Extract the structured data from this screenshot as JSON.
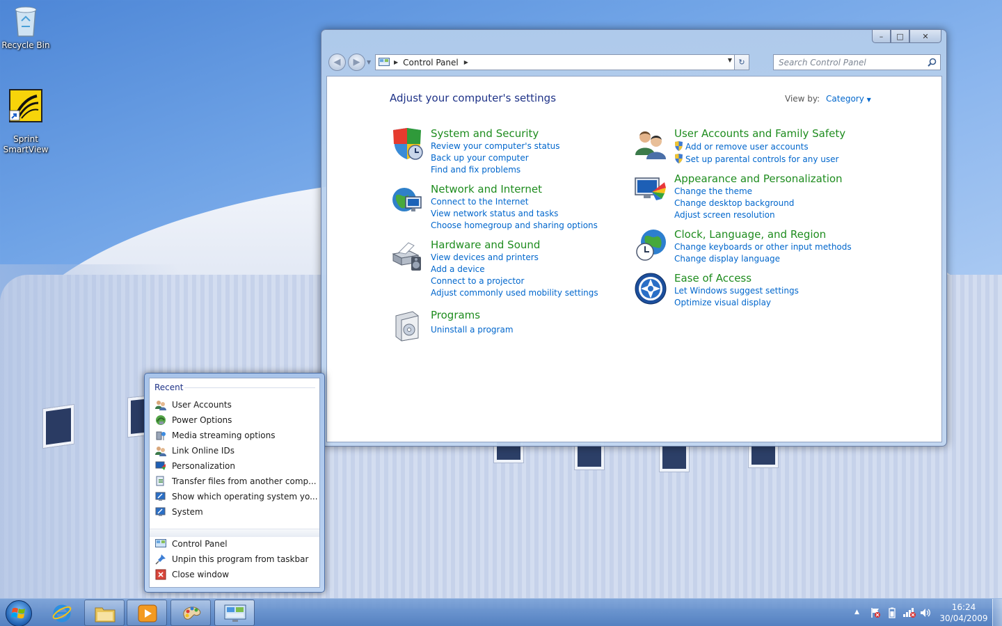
{
  "desktop": {
    "icons": [
      {
        "label": "Recycle Bin",
        "icon": "recycle-bin-icon"
      },
      {
        "label": "Sprint\nSmartView",
        "icon": "sprint-smartview-icon"
      }
    ]
  },
  "window": {
    "breadcrumb": "Control Panel",
    "search_placeholder": "Search Control Panel",
    "title": "Adjust your computer's settings",
    "view_by_label": "View by:",
    "view_by_value": "Category",
    "categories": [
      {
        "title": "System and Security",
        "icon": "shield-check-icon",
        "links": [
          "Review your computer's status",
          "Back up your computer",
          "Find and fix problems"
        ]
      },
      {
        "title": "Network and Internet",
        "icon": "globe-network-icon",
        "links": [
          "Connect to the Internet",
          "View network status and tasks",
          "Choose homegroup and sharing options"
        ]
      },
      {
        "title": "Hardware and Sound",
        "icon": "printer-speaker-icon",
        "links": [
          "View devices and printers",
          "Add a device",
          "Connect to a projector",
          "Adjust commonly used mobility settings"
        ]
      },
      {
        "title": "Programs",
        "icon": "programs-box-icon",
        "links": [
          "Uninstall a program"
        ]
      },
      {
        "title": "User Accounts and Family Safety",
        "icon": "users-icon",
        "links": [
          "Add or remove user accounts",
          "Set up parental controls for any user"
        ]
      },
      {
        "title": "Appearance and Personalization",
        "icon": "monitor-colors-icon",
        "links": [
          "Change the theme",
          "Change desktop background",
          "Adjust screen resolution"
        ]
      },
      {
        "title": "Clock, Language, and Region",
        "icon": "globe-clock-icon",
        "links": [
          "Change keyboards or other input methods",
          "Change display language"
        ]
      },
      {
        "title": "Ease of Access",
        "icon": "ease-of-access-icon",
        "links": [
          "Let Windows suggest settings",
          "Optimize visual display"
        ]
      }
    ]
  },
  "jump_list": {
    "header": "Recent",
    "recent": [
      "User Accounts",
      "Power Options",
      "Media streaming options",
      "Link Online IDs",
      "Personalization",
      "Transfer files from another comp...",
      "Show which operating system yo...",
      "System"
    ],
    "tasks": [
      "Control Panel",
      "Unpin this program from taskbar",
      "Close window"
    ]
  },
  "taskbar": {
    "time": "16:24",
    "date": "30/04/2009"
  },
  "colors": {
    "category_title": "#1e8c1e",
    "link": "#0066cc",
    "heading": "#1e3287"
  }
}
